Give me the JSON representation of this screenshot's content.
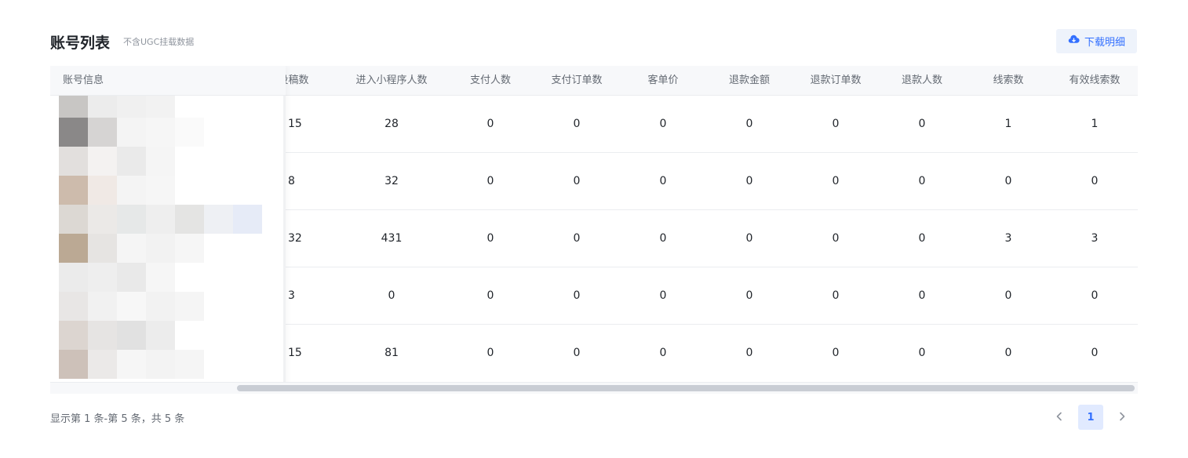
{
  "header": {
    "title": "账号列表",
    "subtitle": "不含UGC挂载数据",
    "download_label": "下载明细",
    "download_icon": "cloud-download-icon",
    "accent": "#3370ff"
  },
  "table": {
    "fixed_column_header": "账号信息",
    "columns": [
      "投稿数",
      "进入小程序人数",
      "支付人数",
      "支付订单数",
      "客单价",
      "退款金额",
      "退款订单数",
      "退款人数",
      "线索数",
      "有效线索数"
    ],
    "rows": [
      [
        "15",
        "28",
        "0",
        "0",
        "0",
        "0",
        "0",
        "0",
        "1",
        "1"
      ],
      [
        "8",
        "32",
        "0",
        "0",
        "0",
        "0",
        "0",
        "0",
        "0",
        "0"
      ],
      [
        "32",
        "431",
        "0",
        "0",
        "0",
        "0",
        "0",
        "0",
        "3",
        "3"
      ],
      [
        "3",
        "0",
        "0",
        "0",
        "0",
        "0",
        "0",
        "0",
        "0",
        "0"
      ],
      [
        "15",
        "81",
        "0",
        "0",
        "0",
        "0",
        "0",
        "0",
        "0",
        "0"
      ]
    ]
  },
  "footer": {
    "summary": "显示第 1 条-第 5 条，共 5 条",
    "current_page": "1",
    "prev_icon": "chevron-left-icon",
    "next_icon": "chevron-right-icon"
  }
}
